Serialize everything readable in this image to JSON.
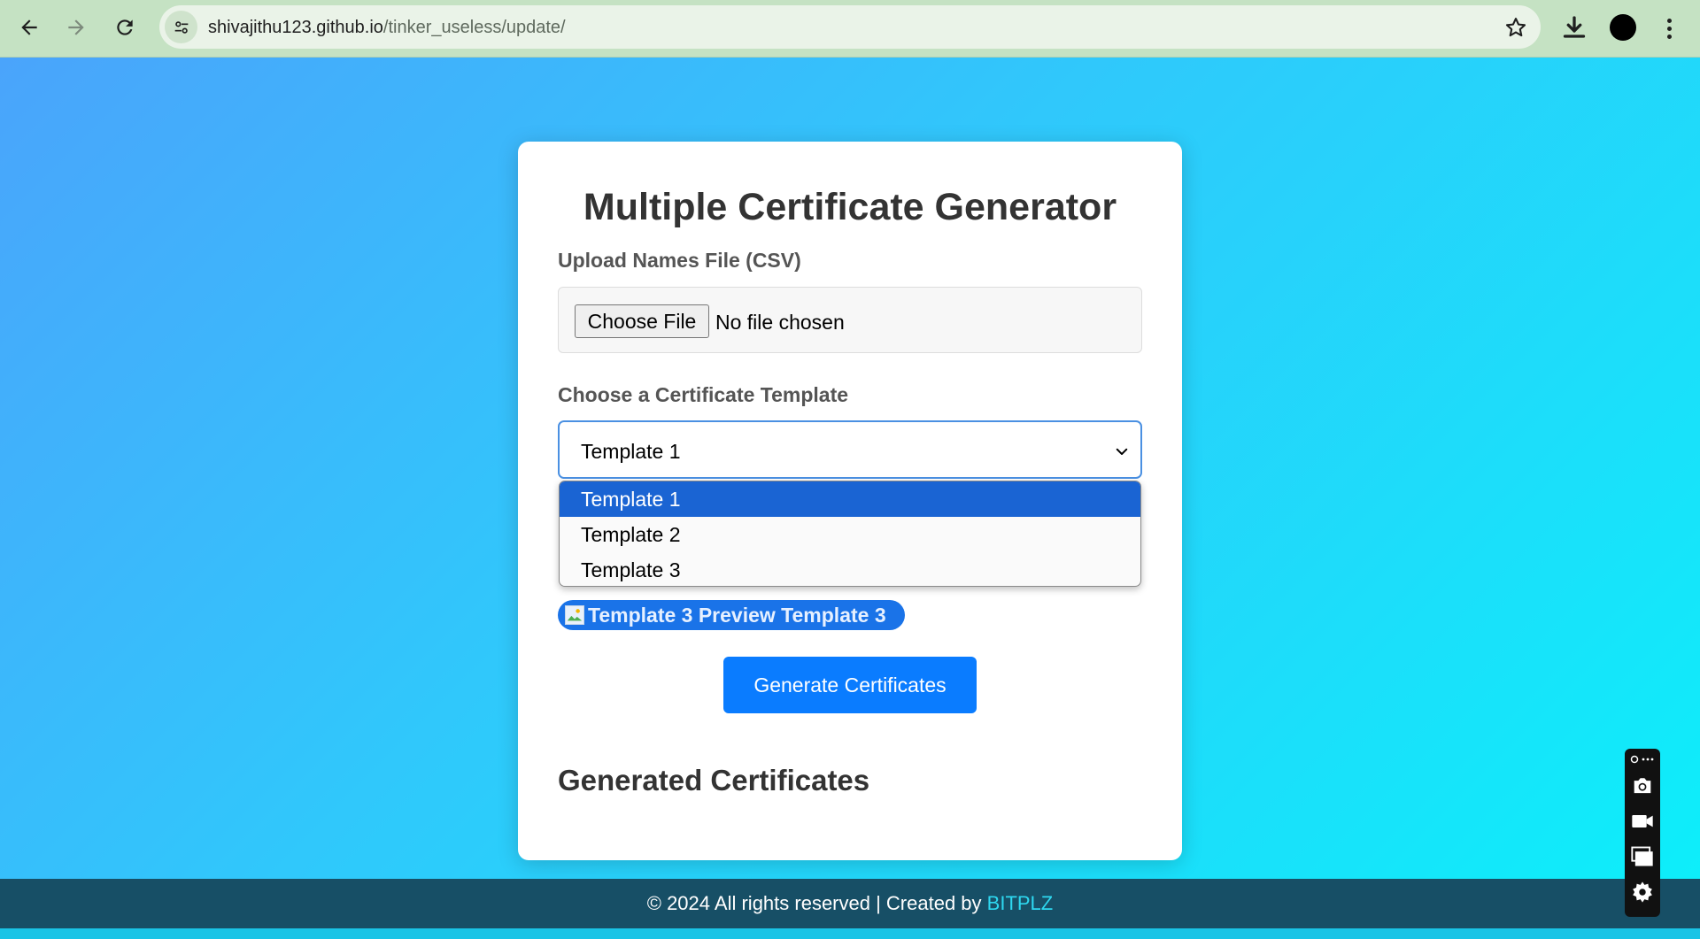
{
  "browser": {
    "url_host": "shivajithu123.github.io",
    "url_path": "/tinker_useless/update/"
  },
  "app": {
    "title": "Multiple Certificate Generator",
    "upload_label": "Upload Names File (CSV)",
    "choose_file_label": "Choose File",
    "file_status": "No file chosen",
    "template_label": "Choose a Certificate Template",
    "selected_template": "Template 1",
    "template_options": [
      "Template 1",
      "Template 2",
      "Template 3"
    ],
    "preview_text": "Template 3 Preview Template 3",
    "generate_button": "Generate Certificates",
    "generated_heading": "Generated Certificates"
  },
  "footer": {
    "text": "© 2024 All rights reserved | Created by ",
    "brand": "BITPLZ"
  },
  "recorder": {
    "icons": [
      "camera-icon",
      "video-icon",
      "screens-icon",
      "settings-icon"
    ]
  },
  "colors": {
    "accent": "#0a7cff",
    "selected_option": "#1a64d3",
    "footer_bg": "#174f66",
    "brand_link": "#2ed8f0"
  }
}
